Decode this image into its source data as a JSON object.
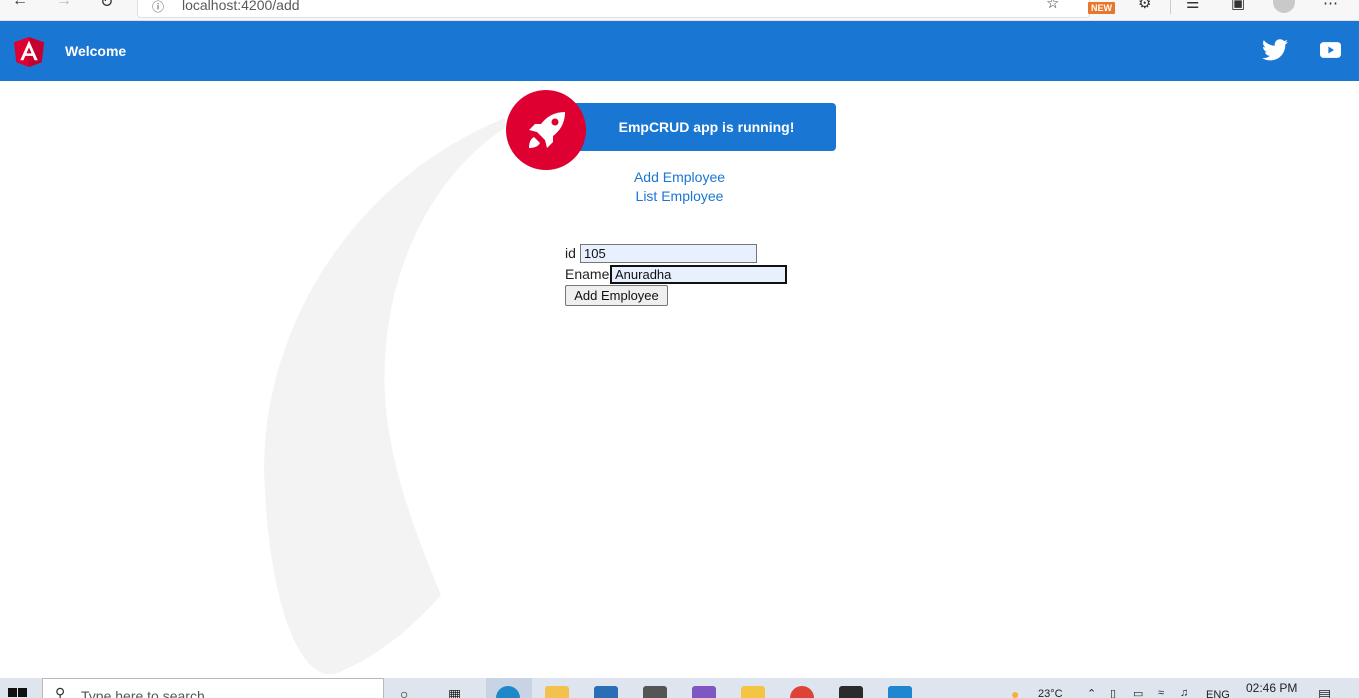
{
  "browser": {
    "url": "localhost:4200/add",
    "new_badge": "NEW",
    "icons": [
      "back-icon",
      "forward-icon",
      "refresh-icon",
      "site-info-icon",
      "add-favorite-icon",
      "extensions-icon",
      "favorites-icon",
      "collections-icon",
      "profile-icon",
      "more-icon"
    ]
  },
  "header": {
    "title": "Welcome",
    "brand_color": "#1976d2",
    "logo_color": "#dd0031",
    "icons": [
      "angular-logo-icon",
      "twitter-icon",
      "youtube-icon"
    ]
  },
  "card": {
    "title": "EmpCRUD app is running!",
    "icon": "rocket-icon"
  },
  "nav": {
    "links": [
      "Add Employee",
      "List Employee"
    ]
  },
  "form": {
    "id_label": "id",
    "id_value": "105",
    "ename_label": "Ename",
    "ename_value": "Anuradha",
    "submit_label": "Add Employee"
  },
  "taskbar": {
    "search_placeholder": "Type here to search",
    "temperature": "23°C",
    "language": "ENG",
    "time": "02:46 PM",
    "icons": [
      "windows-start-icon",
      "search-icon",
      "task-view-icon",
      "edge-icon",
      "file-explorer-icon",
      "mail-icon",
      "media-icon",
      "visual-studio-icon",
      "sticky-notes-icon",
      "chrome-icon",
      "app-icon",
      "vscode-icon",
      "weather-icon",
      "notification-icon"
    ]
  }
}
